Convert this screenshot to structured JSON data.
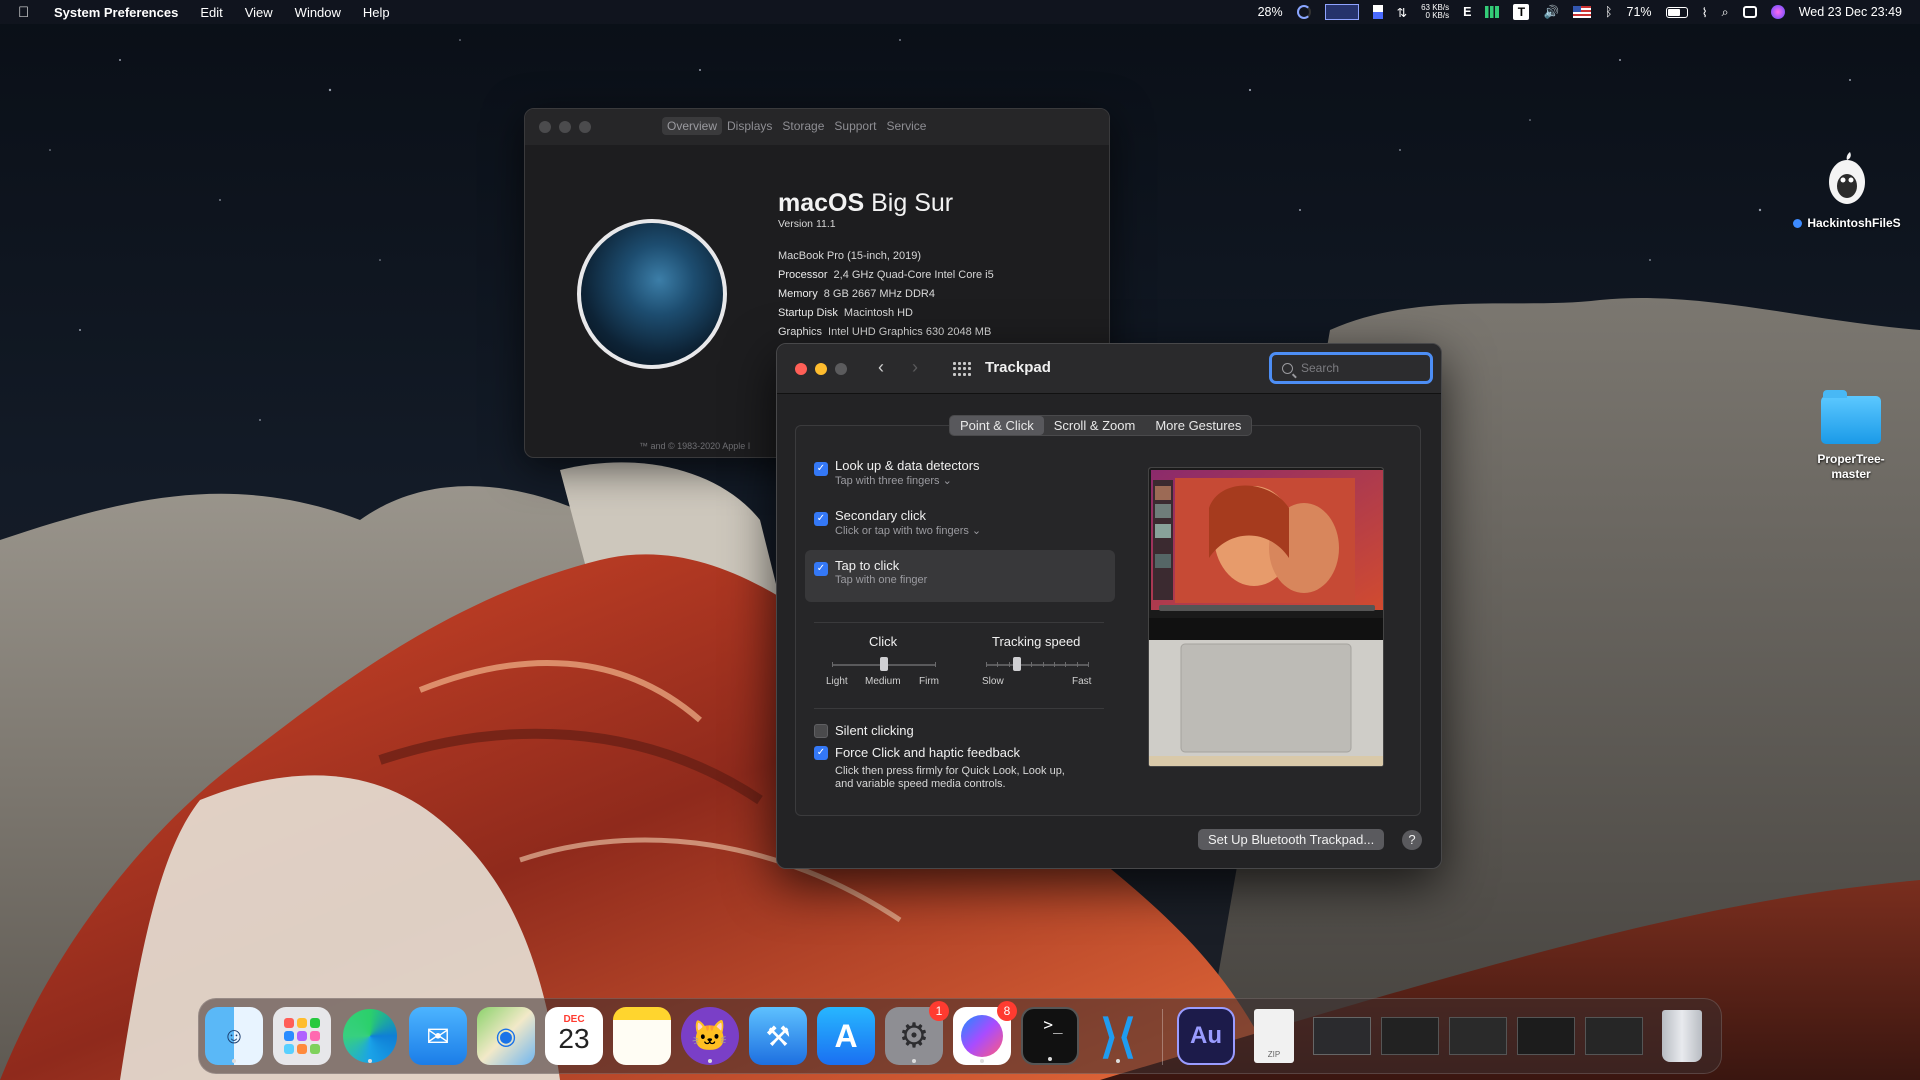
{
  "menubar": {
    "app": "System Preferences",
    "items": [
      "Edit",
      "View",
      "Window",
      "Help"
    ],
    "status": {
      "cpu_percent": "28%",
      "net_up": "63 KB/s",
      "net_down": "0 KB/s",
      "input_letter": "E",
      "t_label": "T",
      "battery_percent": "71%",
      "datetime": "Wed 23 Dec  23:49"
    }
  },
  "desktop": {
    "icons": [
      {
        "label": "HackintoshFileS"
      },
      {
        "label": "ProperTree-\nmaster"
      }
    ]
  },
  "about": {
    "tabs": [
      "Overview",
      "Displays",
      "Storage",
      "Support",
      "Service"
    ],
    "active_tab": "Overview",
    "os_name_bold": "macOS",
    "os_name_rest": " Big Sur",
    "version": "Version 11.1",
    "model": "MacBook Pro (15-inch, 2019)",
    "processor_label": "Processor",
    "processor": "2,4 GHz Quad-Core Intel Core i5",
    "memory_label": "Memory",
    "memory": "8 GB 2667 MHz DDR4",
    "disk_label": "Startup Disk",
    "disk": "Macintosh HD",
    "graphics_label": "Graphics",
    "graphics": "Intel UHD Graphics 630 2048 MB",
    "copyright": "™ and © 1983-2020 Apple I"
  },
  "trackpad": {
    "title": "Trackpad",
    "search_placeholder": "Search",
    "tabs": [
      "Point & Click",
      "Scroll & Zoom",
      "More Gestures"
    ],
    "active_tab": "Point & Click",
    "options": [
      {
        "label": "Look up & data detectors",
        "sub": "Tap with three fingers ⌄",
        "checked": true
      },
      {
        "label": "Secondary click",
        "sub": "Click or tap with two fingers ⌄",
        "checked": true
      },
      {
        "label": "Tap to click",
        "sub": "Tap with one finger",
        "checked": true
      }
    ],
    "click": {
      "label": "Click",
      "ticks": [
        "Light",
        "Medium",
        "Firm"
      ],
      "value": "Medium"
    },
    "tracking": {
      "label": "Tracking speed",
      "ticks": [
        "Slow",
        "Fast"
      ],
      "value_fraction": 0.3
    },
    "silent_clicking": {
      "label": "Silent clicking",
      "checked": false
    },
    "force_click": {
      "label": "Force Click and haptic feedback",
      "checked": true,
      "desc_line1": "Click then press firmly for Quick Look, Look up,",
      "desc_line2": "and variable speed media controls."
    },
    "bluetooth_button": "Set Up Bluetooth Trackpad...",
    "help_button": "?"
  },
  "dock": {
    "calendar_month": "DEC",
    "calendar_day": "23",
    "badges": {
      "system_preferences": "1",
      "messenger": "8"
    },
    "au_label": "Au",
    "zip_label": "ZIP"
  },
  "colors": {
    "accent": "#3478f6",
    "close": "#ff5f57",
    "minimize": "#febc2e"
  }
}
